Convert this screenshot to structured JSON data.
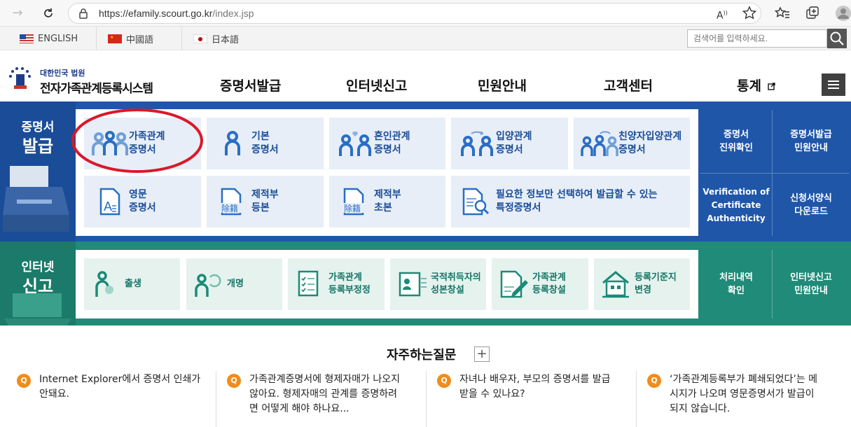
{
  "browser": {
    "url_host": "https://efamily.scourt.go.kr",
    "url_path": "/index.jsp"
  },
  "languages": [
    {
      "label": "ENGLISH"
    },
    {
      "label": "中國語"
    },
    {
      "label": "日本語"
    }
  ],
  "search": {
    "placeholder": "검색어를 입력하세요."
  },
  "header": {
    "logo_sub": "대한민국 법원",
    "logo_title": "전자가족관계등록시스템",
    "menu": [
      "증명서발급",
      "인터넷신고",
      "민원안내",
      "고객센터",
      "통계"
    ]
  },
  "cert": {
    "label_top": "증명서",
    "label_bottom": "발급",
    "tiles": [
      {
        "label": "가족관계\n증명서",
        "icon": "family-icon"
      },
      {
        "label": "기본\n증명서",
        "icon": "person-icon"
      },
      {
        "label": "혼인관계\n증명서",
        "icon": "couple-heart-icon"
      },
      {
        "label": "입양관계\n증명서",
        "icon": "adoption-icon"
      },
      {
        "label": "친양자입양관계\n증명서",
        "icon": "family-adoption-icon"
      },
      {
        "label": "영문\n증명서",
        "icon": "english-doc-icon"
      },
      {
        "label": "제적부\n등본",
        "icon": "register-doc-icon"
      },
      {
        "label": "제적부\n초본",
        "icon": "register-doc-icon"
      },
      {
        "label": "필요한 정보만 선택하여 발급할 수 있는\n특정증명서",
        "icon": "doc-search-icon"
      }
    ],
    "side": [
      {
        "label": "증명서\n진위확인"
      },
      {
        "label": "증명서발급\n민원안내"
      },
      {
        "label": "Verification of\nCertificate\nAuthenticity"
      },
      {
        "label": "신청서양식\n다운로드"
      }
    ],
    "doc_icon_text": "除籍"
  },
  "report": {
    "label_top": "인터넷",
    "label_bottom": "신고",
    "tiles": [
      {
        "label": "출생",
        "icon": "birth-icon"
      },
      {
        "label": "개명",
        "icon": "rename-icon"
      },
      {
        "label": "가족관계\n등록부정정",
        "icon": "checklist-icon"
      },
      {
        "label": "국적취득자의\n성본창설",
        "icon": "id-card-icon"
      },
      {
        "label": "가족관계\n등록창설",
        "icon": "doc-pen-icon"
      },
      {
        "label": "등록기준지\n변경",
        "icon": "house-icon"
      }
    ],
    "side": [
      {
        "label": "처리내역\n확인"
      },
      {
        "label": "인터넷신고\n민원안내"
      }
    ]
  },
  "faq": {
    "title": "자주하는질문",
    "plus": "+",
    "q_badge": "Q",
    "items": [
      {
        "text": "Internet Explorer에서 증명서 인쇄가\n안돼요."
      },
      {
        "text": "가족관계증명서에 형제자매가 나오지\n않아요. 형제자매의 관계를 증명하려\n면 어떻게 해야 하나요..."
      },
      {
        "text": "자녀나 배우자, 부모의 증명서를 발급\n받을 수 있나요?"
      },
      {
        "text": "‘가족관계등록부가 폐쇄되었다’는 메\n시지가 나오며 영문증명서가 발급이\n되지 않습니다."
      }
    ]
  },
  "colors": {
    "cert_blue": "#1f56a8",
    "report_green": "#1f8b78",
    "faq_orange": "#f08c1a",
    "highlight_red": "#d9182a"
  }
}
